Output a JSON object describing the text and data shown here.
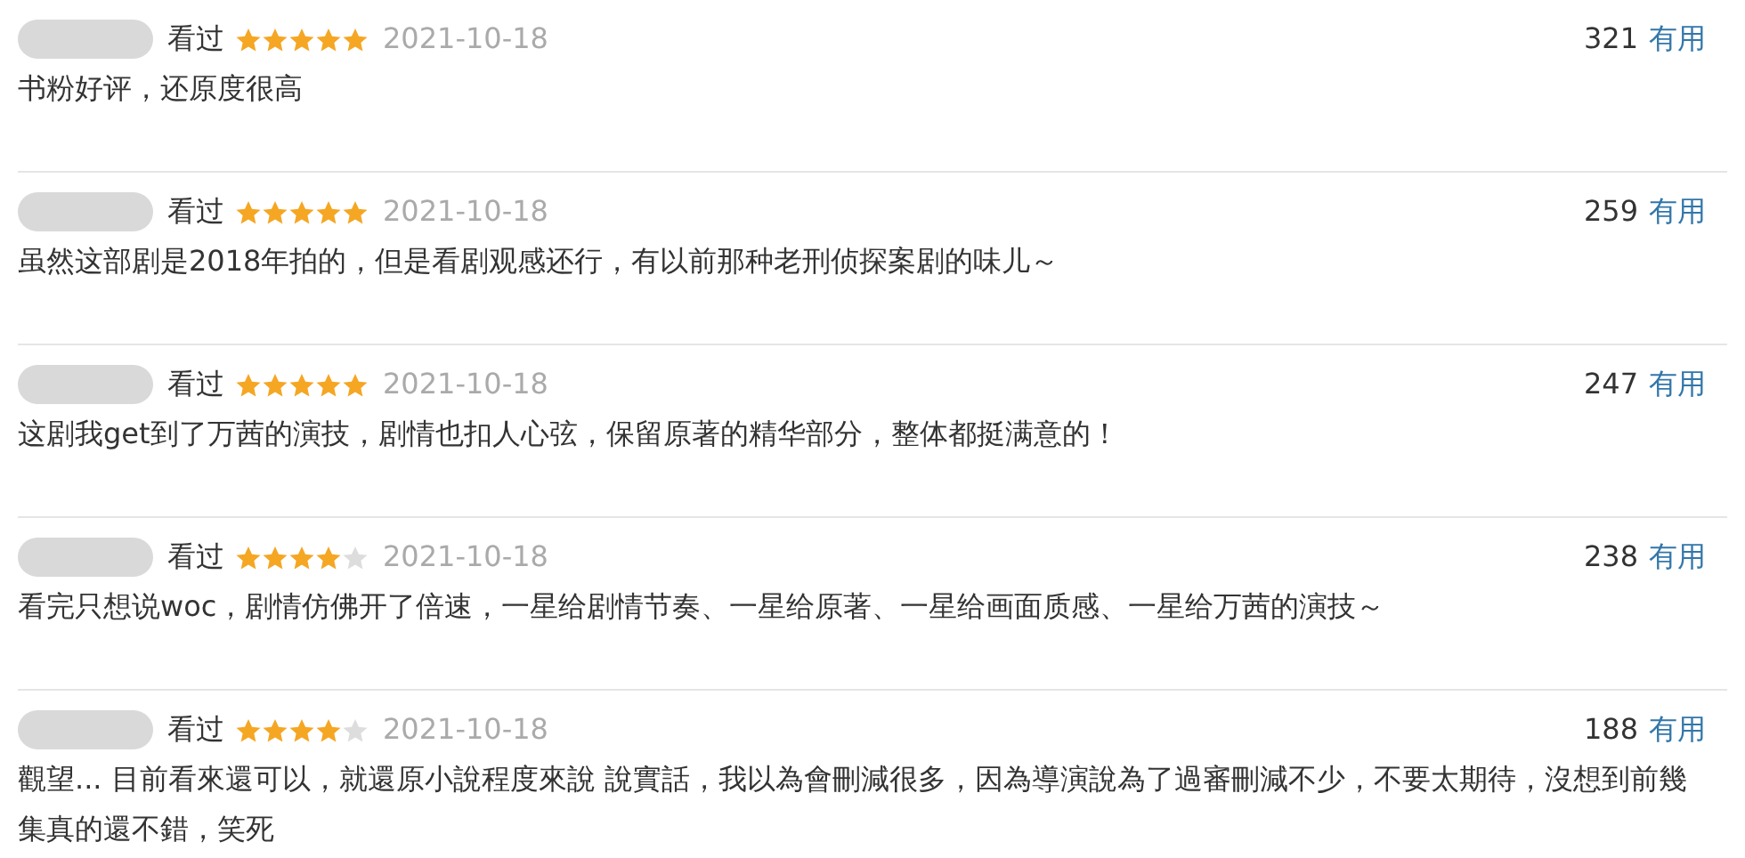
{
  "reviews": [
    {
      "status": "看过",
      "stars": 5,
      "date": "2021-10-18",
      "votes": "321",
      "vote_label": "有用",
      "text": "书粉好评，还原度很高"
    },
    {
      "status": "看过",
      "stars": 5,
      "date": "2021-10-18",
      "votes": "259",
      "vote_label": "有用",
      "text": "虽然这部剧是2018年拍的，但是看剧观感还行，有以前那种老刑侦探案剧的味儿～"
    },
    {
      "status": "看过",
      "stars": 5,
      "date": "2021-10-18",
      "votes": "247",
      "vote_label": "有用",
      "text": "这剧我get到了万茜的演技，剧情也扣人心弦，保留原著的精华部分，整体都挺满意的！"
    },
    {
      "status": "看过",
      "stars": 4,
      "date": "2021-10-18",
      "votes": "238",
      "vote_label": "有用",
      "text": "看完只想说woc，剧情仿佛开了倍速，一星给剧情节奏、一星给原著、一星给画面质感、一星给万茜的演技～"
    },
    {
      "status": "看过",
      "stars": 4,
      "date": "2021-10-18",
      "votes": "188",
      "vote_label": "有用",
      "text": "觀望... 目前看來還可以，就還原小說程度來說 說實話，我以為會刪減很多，因為導演說為了過審刪減不少，不要太期待，沒想到前幾集真的還不錯，笑死"
    }
  ]
}
